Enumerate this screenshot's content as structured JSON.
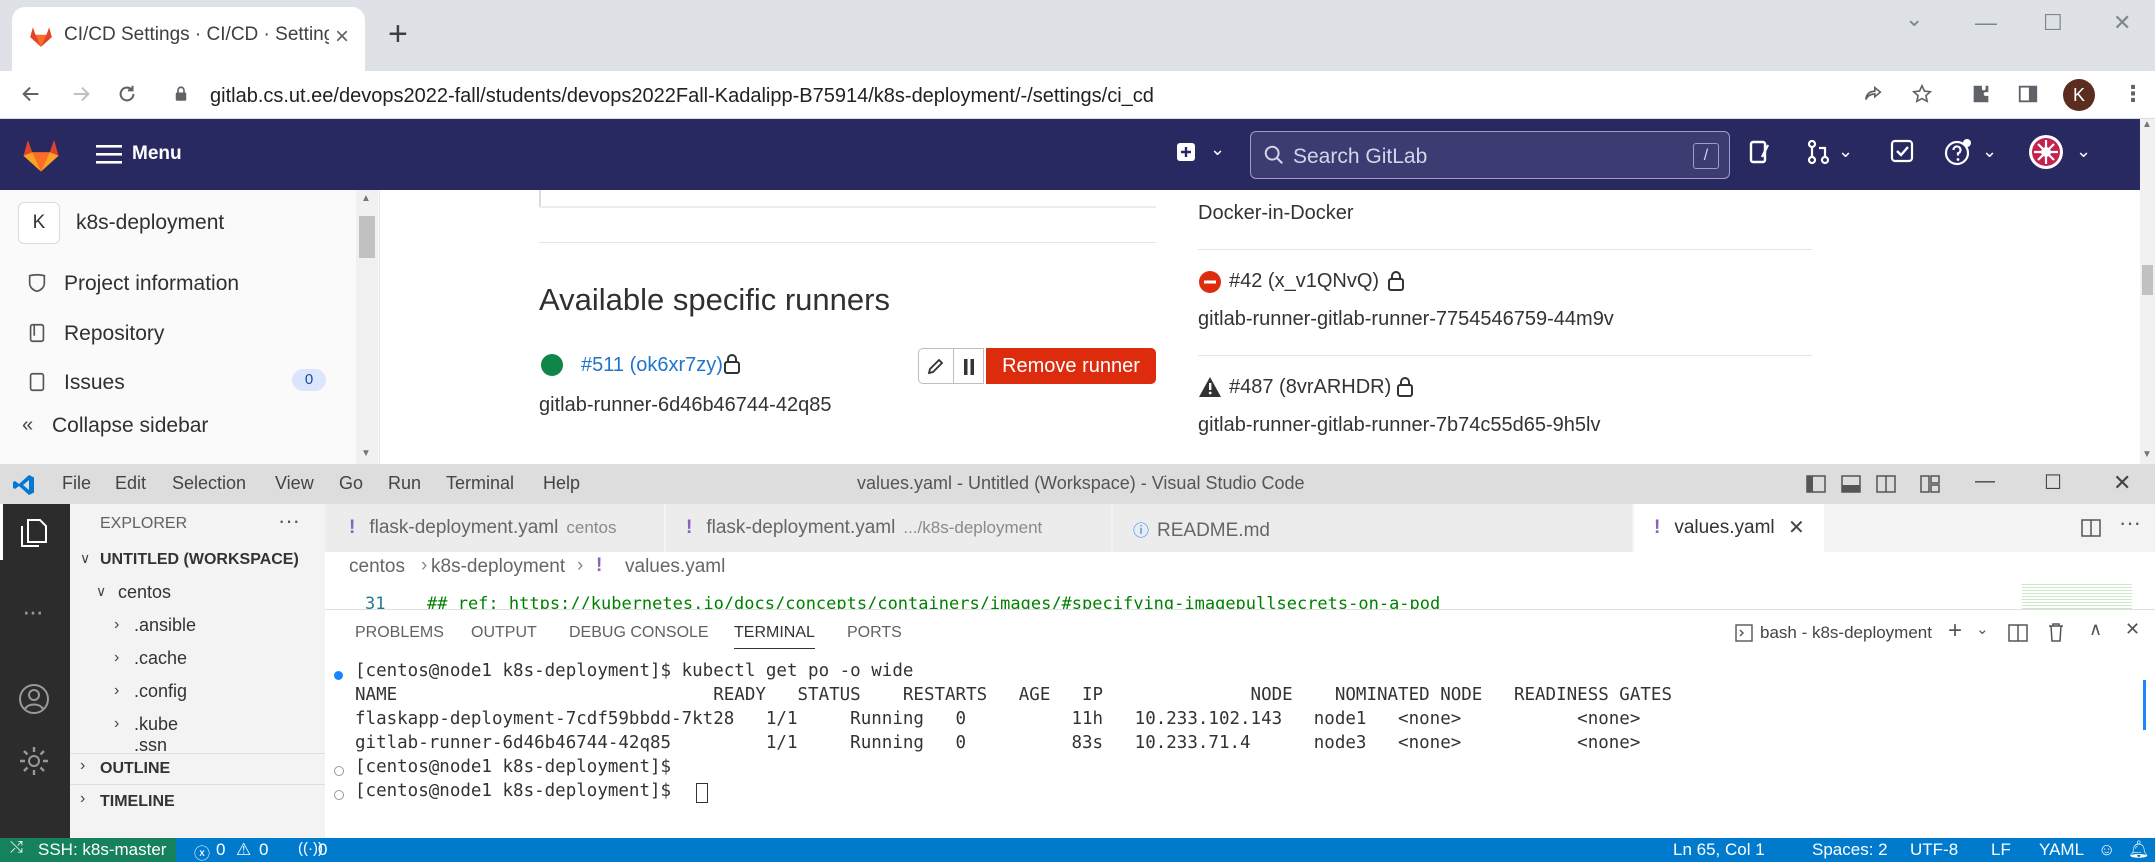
{
  "browser": {
    "tab_title": "CI/CD Settings · CI/CD · Settings",
    "url": "gitlab.cs.ut.ee/devops2022-fall/students/devops2022Fall-Kadalipp-B75914/k8s-deployment/-/settings/ci_cd",
    "profile_initial": "K"
  },
  "gitlab": {
    "menu_label": "Menu",
    "search_placeholder": "Search GitLab",
    "search_shortcut": "/",
    "sidebar": {
      "project_initial": "K",
      "project_name": "k8s-deployment",
      "items": [
        {
          "label": "Project information"
        },
        {
          "label": "Repository"
        },
        {
          "label": "Issues",
          "badge": "0"
        }
      ],
      "collapse_label": "Collapse sidebar"
    },
    "content": {
      "heading": "Available specific runners",
      "specific_runner": {
        "id_label": "#511 (ok6xr7zy)",
        "name": "gitlab-runner-6d46b46744-42q85",
        "remove_label": "Remove runner"
      },
      "right_top_text": "Docker-in-Docker",
      "other_runners": [
        {
          "id_label": "#42 (x_v1QNvQ)",
          "name": "gitlab-runner-gitlab-runner-7754546759-44m9v"
        },
        {
          "id_label": "#487 (8vrARHDR)",
          "name": "gitlab-runner-gitlab-runner-7b74c55d65-9h5lv"
        }
      ]
    }
  },
  "vscode": {
    "menu": [
      "File",
      "Edit",
      "Selection",
      "View",
      "Go",
      "Run",
      "Terminal",
      "Help"
    ],
    "title": "values.yaml - Untitled (Workspace) - Visual Studio Code",
    "explorer": {
      "header": "EXPLORER",
      "workspace": "UNTITLED (WORKSPACE)",
      "root": "centos",
      "folders": [
        ".ansible",
        ".cache",
        ".config",
        ".kube",
        ".ssh"
      ],
      "outline": "OUTLINE",
      "timeline": "TIMELINE"
    },
    "tabs": [
      {
        "name": "flask-deployment.yaml",
        "detail": "centos"
      },
      {
        "name": "flask-deployment.yaml",
        "detail": ".../k8s-deployment"
      },
      {
        "name": "README.md",
        "detail": ""
      },
      {
        "name": "values.yaml",
        "detail": ""
      }
    ],
    "breadcrumb": [
      "centos",
      "k8s-deployment",
      "values.yaml"
    ],
    "editor_line_no": "31",
    "editor_line": "## ref: https://kubernetes.io/docs/concepts/containers/images/#specifying-imagepullsecrets-on-a-pod",
    "panel_tabs": [
      "PROBLEMS",
      "OUTPUT",
      "DEBUG CONSOLE",
      "TERMINAL",
      "PORTS"
    ],
    "terminal_name": "bash - k8s-deployment",
    "terminal_lines": [
      "[centos@node1 k8s-deployment]$ kubectl get po -o wide",
      "NAME                              READY   STATUS    RESTARTS   AGE   IP              NODE    NOMINATED NODE   READINESS GATES",
      "flaskapp-deployment-7cdf59bbdd-7kt28   1/1     Running   0          11h   10.233.102.143   node1   <none>           <none>",
      "gitlab-runner-6d46b46744-42q85         1/1     Running   0          83s   10.233.71.4      node3   <none>           <none>",
      "[centos@node1 k8s-deployment]$",
      "[centos@node1 k8s-deployment]$ "
    ],
    "status": {
      "remote": "SSH: k8s-master",
      "errors": "0",
      "warnings": "0",
      "ports": "0",
      "position": "Ln 65, Col 1",
      "spaces": "Spaces: 2",
      "encoding": "UTF-8",
      "eol": "LF",
      "language": "YAML"
    }
  }
}
